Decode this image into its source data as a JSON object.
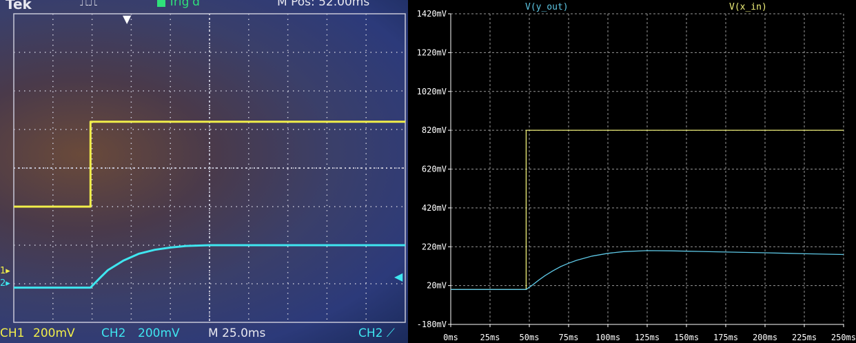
{
  "scope": {
    "brand": "Tek",
    "trig_status": "Trig'd",
    "m_pos": "M Pos: 52.00ms",
    "ch1_label": "CH1",
    "ch1_scale": "200mV",
    "ch2_label": "CH2",
    "ch2_scale": "200mV",
    "timebase": "M 25.0ms",
    "trigger_source": "CH2",
    "marker_ch1": "1",
    "marker_ch2": "2"
  },
  "chart_data": [
    {
      "type": "line",
      "title": "",
      "xlabel": "",
      "ylabel": "",
      "x_unit": "ms",
      "xlim": [
        0,
        250
      ],
      "series": [
        {
          "name": "",
          "color": "#f2ef4a",
          "x": [
            0,
            49,
            49,
            250
          ],
          "y": [
            -1.0,
            -1.0,
            1.2,
            1.2
          ]
        },
        {
          "name": "",
          "color": "#3fe6f0",
          "x": [
            0,
            49,
            55,
            60,
            70,
            80,
            90,
            100,
            110,
            125,
            150,
            175,
            200,
            225,
            250
          ],
          "y": [
            -3.1,
            -3.1,
            -2.85,
            -2.65,
            -2.4,
            -2.22,
            -2.12,
            -2.06,
            -2.02,
            -2.0,
            -2.0,
            -2.0,
            -2.0,
            -2.0,
            -2.0
          ]
        }
      ],
      "grid": true,
      "colors": {
        "background": "#3a3f6a",
        "grid": "#c8c8d8"
      }
    },
    {
      "type": "line",
      "title": "",
      "xlabel": "",
      "ylabel": "",
      "x_ticks": [
        "0ms",
        "25ms",
        "50ms",
        "75ms",
        "100ms",
        "125ms",
        "150ms",
        "175ms",
        "200ms",
        "225ms",
        "250ms"
      ],
      "y_ticks": [
        "-180mV",
        "20mV",
        "220mV",
        "420mV",
        "620mV",
        "820mV",
        "1020mV",
        "1220mV",
        "1420mV"
      ],
      "xlim": [
        0,
        250
      ],
      "ylim": [
        -180,
        1420
      ],
      "x_unit": "ms",
      "y_unit": "mV",
      "series": [
        {
          "name": "V(x_in)",
          "color": "#f2f27a",
          "x": [
            0,
            48,
            48,
            250
          ],
          "y": [
            0,
            0,
            820,
            820
          ]
        },
        {
          "name": "V(y_out)",
          "color": "#5ec8e6",
          "x": [
            0,
            48,
            52,
            56,
            60,
            65,
            70,
            75,
            80,
            90,
            100,
            110,
            125,
            140,
            150,
            175,
            200,
            225,
            250
          ],
          "y": [
            0,
            0,
            23,
            48,
            71,
            96,
            118,
            135,
            150,
            172,
            186,
            195,
            200,
            199,
            197,
            193,
            189,
            184,
            180
          ]
        }
      ],
      "grid": true,
      "colors": {
        "background": "#000000",
        "grid": "#9a9a9a",
        "axis": "#ffffff",
        "tick_label": "#ffffff"
      }
    }
  ]
}
